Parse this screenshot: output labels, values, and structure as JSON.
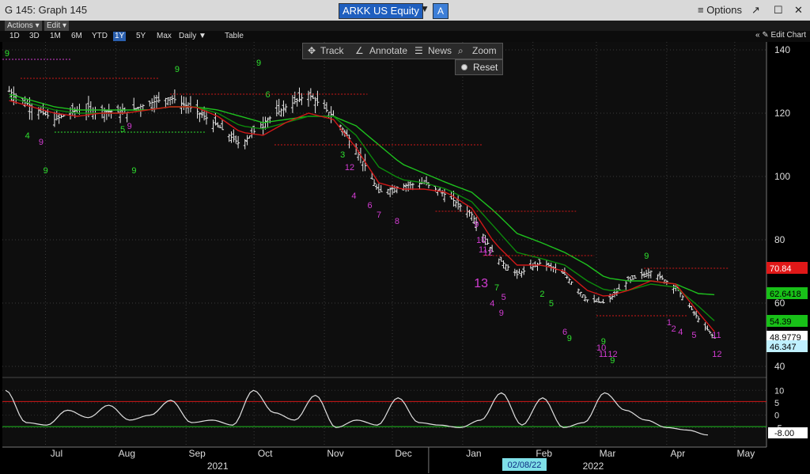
{
  "window": {
    "title": "G 145: Graph 145",
    "ticker": "ARKK US Equity",
    "mode_button": "A",
    "options_label": "≡ Options"
  },
  "menu": {
    "actions": "Actions ▾",
    "edit": "Edit ▾"
  },
  "ranges": [
    "1D",
    "3D",
    "1M",
    "6M",
    "YTD",
    "1Y",
    "5Y",
    "Max"
  ],
  "selected_range": "1Y",
  "period": "Daily ▼",
  "table_label": "Table",
  "edit_chart": "« ✎ Edit Chart",
  "toolbox": {
    "track": "Track",
    "annotate": "Annotate",
    "news": "News",
    "zoom": "Zoom",
    "reset": "Reset"
  },
  "colors": {
    "price_bars": "#e8e8e8",
    "ma_fast": "#d01818",
    "ma_mid": "#0c8a0c",
    "ma_slow": "#1ec01e",
    "seq_green": "#2fe02f",
    "seq_magenta": "#d23cd2",
    "osc_line": "#e0e0e0",
    "upper_band": "#d01818",
    "lower_band": "#1ec01e",
    "cursor_date_bg": "#7fe0e8"
  },
  "chart_data": {
    "type": "candlestick",
    "subtype": "OHLC daily bars with moving averages and sequential counts",
    "x": [
      "2021-06-15",
      "2021-06-25",
      "2021-07-05",
      "2021-07-15",
      "2021-07-25",
      "2021-08-05",
      "2021-08-15",
      "2021-08-25",
      "2021-09-05",
      "2021-09-15",
      "2021-09-25",
      "2021-10-05",
      "2021-10-15",
      "2021-10-25",
      "2021-11-05",
      "2021-11-15",
      "2021-11-25",
      "2021-12-05",
      "2021-12-15",
      "2021-12-25",
      "2022-01-05",
      "2022-01-15",
      "2022-01-25",
      "2022-02-05",
      "2022-02-15",
      "2022-02-25",
      "2022-03-05",
      "2022-03-15",
      "2022-03-25",
      "2022-04-05",
      "2022-04-15",
      "2022-04-22"
    ],
    "close": [
      127,
      122,
      118,
      121,
      121,
      120,
      123,
      125,
      121,
      116,
      110,
      117,
      122,
      126,
      119,
      109,
      95,
      97,
      98,
      94,
      88,
      75,
      69,
      73,
      69,
      61,
      60,
      67,
      70,
      65,
      55,
      48.98
    ],
    "ma_fast_red": [
      124,
      122,
      120,
      119,
      120,
      120,
      121,
      122,
      122,
      119,
      114,
      113,
      117,
      120,
      118,
      109,
      98,
      96,
      96,
      95,
      90,
      79,
      72,
      72,
      70,
      64,
      62,
      64,
      67,
      66,
      57,
      51
    ],
    "ma_mid_green": [
      125,
      123,
      121,
      120,
      120,
      120,
      121,
      122,
      122,
      120,
      116,
      115,
      117,
      119,
      119,
      113,
      103,
      99,
      98,
      96,
      92,
      84,
      76,
      74,
      72,
      67,
      64,
      64,
      66,
      65,
      59,
      54.39
    ],
    "ma_slow_green": [
      126,
      124,
      122,
      121,
      121,
      121,
      121,
      122,
      122,
      121,
      119,
      117,
      118,
      119,
      119,
      116,
      110,
      104,
      101,
      98,
      95,
      89,
      82,
      79,
      76,
      72,
      68,
      67,
      67,
      66,
      63,
      62.64
    ],
    "y_axis": {
      "ticks": [
        40,
        60,
        80,
        100,
        120,
        140
      ],
      "ylim": [
        37,
        142
      ]
    },
    "x_axis": {
      "months": [
        "Jul",
        "Aug",
        "Sep",
        "Oct",
        "Nov",
        "Dec",
        "Jan",
        "Feb",
        "Mar",
        "Apr",
        "May"
      ],
      "years": [
        "2021",
        "2022"
      ]
    },
    "price_labels": [
      {
        "value": 70.84,
        "text": "70.84",
        "bg": "#e01818",
        "fg": "#fff"
      },
      {
        "value": 62.6418,
        "text": "62.6418",
        "bg": "#18c018",
        "fg": "#000"
      },
      {
        "value": 54.39,
        "text": "54.39",
        "bg": "#18c018",
        "fg": "#000"
      },
      {
        "value": 48.9779,
        "text": "48.9779",
        "bg": "#ffffff",
        "fg": "#000"
      },
      {
        "value": 46.347,
        "text": "46.347",
        "bg": "#bff0ff",
        "fg": "#000"
      }
    ],
    "oscillator": {
      "values": [
        10,
        -3,
        -4,
        2,
        -1,
        4,
        -2,
        0,
        6,
        -3,
        -2,
        -4,
        10,
        1,
        -2,
        8,
        -5,
        -2,
        -4,
        7,
        -3,
        -4,
        -5,
        -2,
        9,
        -4,
        7,
        -5,
        -3,
        9,
        2,
        -2,
        -5,
        -6,
        -8
      ],
      "ticks": [
        10,
        5,
        0,
        -5
      ],
      "upper": 5.5,
      "lower": -4.6,
      "last_label": "-8.00"
    },
    "cursor_date": "02/08/22",
    "title": ""
  }
}
